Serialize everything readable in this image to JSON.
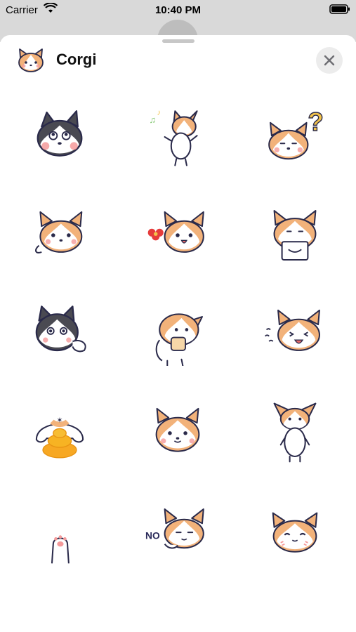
{
  "status_bar": {
    "carrier": "Carrier",
    "time": "10:40 PM"
  },
  "sheet": {
    "title": "Corgi",
    "close_icon": "close-icon",
    "app_icon": "corgi-face-icon"
  },
  "stickers": [
    {
      "name": "husky-thinking-sticker"
    },
    {
      "name": "corgi-dancing-music-sticker"
    },
    {
      "name": "corgi-question-mark-sticker"
    },
    {
      "name": "corgi-waving-sticker"
    },
    {
      "name": "corgi-flower-sticker"
    },
    {
      "name": "corgi-holding-sign-sticker"
    },
    {
      "name": "husky-peeking-sticker"
    },
    {
      "name": "corgi-holding-cat-sticker"
    },
    {
      "name": "corgi-laughing-sticker"
    },
    {
      "name": "corgi-poop-sticker"
    },
    {
      "name": "corgi-smiling-sticker"
    },
    {
      "name": "corgi-standing-sticker"
    },
    {
      "name": "corgi-paw-sticker"
    },
    {
      "name": "corgi-no-sticker",
      "text": "NO"
    },
    {
      "name": "corgi-content-sticker"
    }
  ],
  "colors": {
    "corgi_orange": "#f2b27a",
    "outline": "#2a2a4a",
    "husky_gray": "#4a4a52",
    "blush": "#f59a9a"
  }
}
